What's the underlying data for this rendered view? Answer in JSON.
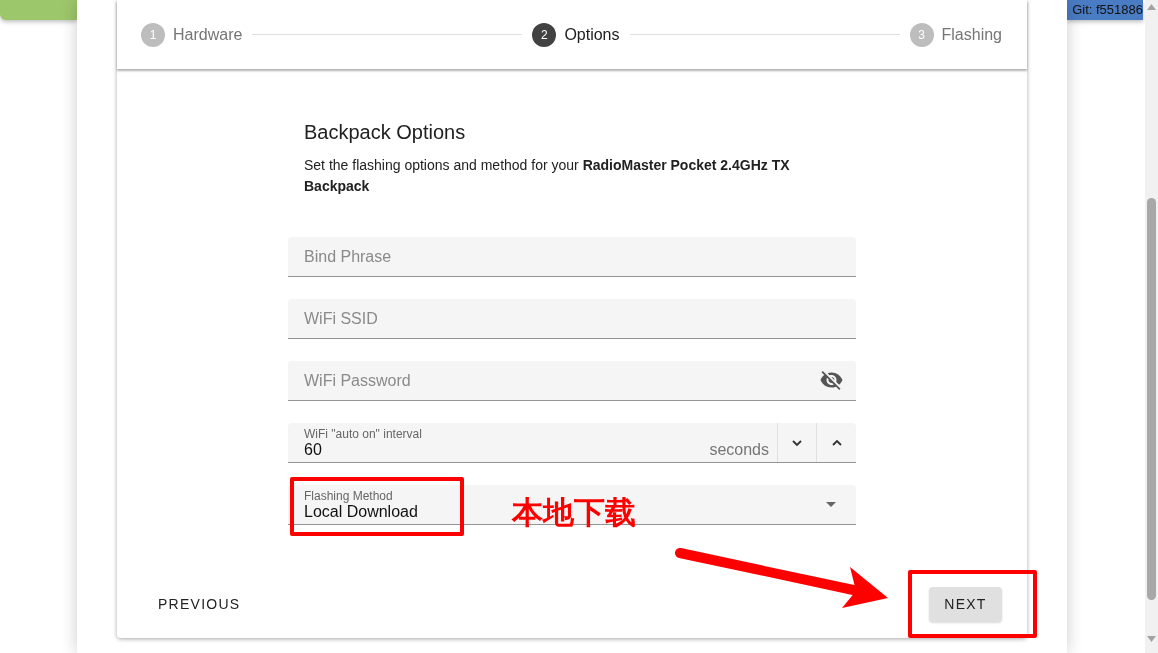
{
  "top_bar": {
    "badge": "Git: f551886"
  },
  "stepper": {
    "steps": [
      {
        "number": "1",
        "label": "Hardware",
        "active": false
      },
      {
        "number": "2",
        "label": "Options",
        "active": true
      },
      {
        "number": "3",
        "label": "Flashing",
        "active": false
      }
    ]
  },
  "section": {
    "title": "Backpack Options",
    "description": "Set the flashing options and method for your **RadioMaster Pocket 2.4GHz TX Backpack**"
  },
  "fields": [
    {
      "kind": "text",
      "placeholder": "Bind Phrase"
    },
    {
      "kind": "text",
      "placeholder": "WiFi SSID"
    },
    {
      "kind": "password",
      "placeholder": "WiFi Password",
      "password_visible": false
    },
    {
      "kind": "number",
      "label": "WiFi \"auto on\" interval",
      "value": "60",
      "suffix": "seconds"
    },
    {
      "kind": "select",
      "label": "Flashing Method",
      "value": "Local Download"
    }
  ],
  "buttons": {
    "previous": "PREVIOUS",
    "next": "NEXT"
  },
  "annotation": {
    "label": "本地下载"
  }
}
